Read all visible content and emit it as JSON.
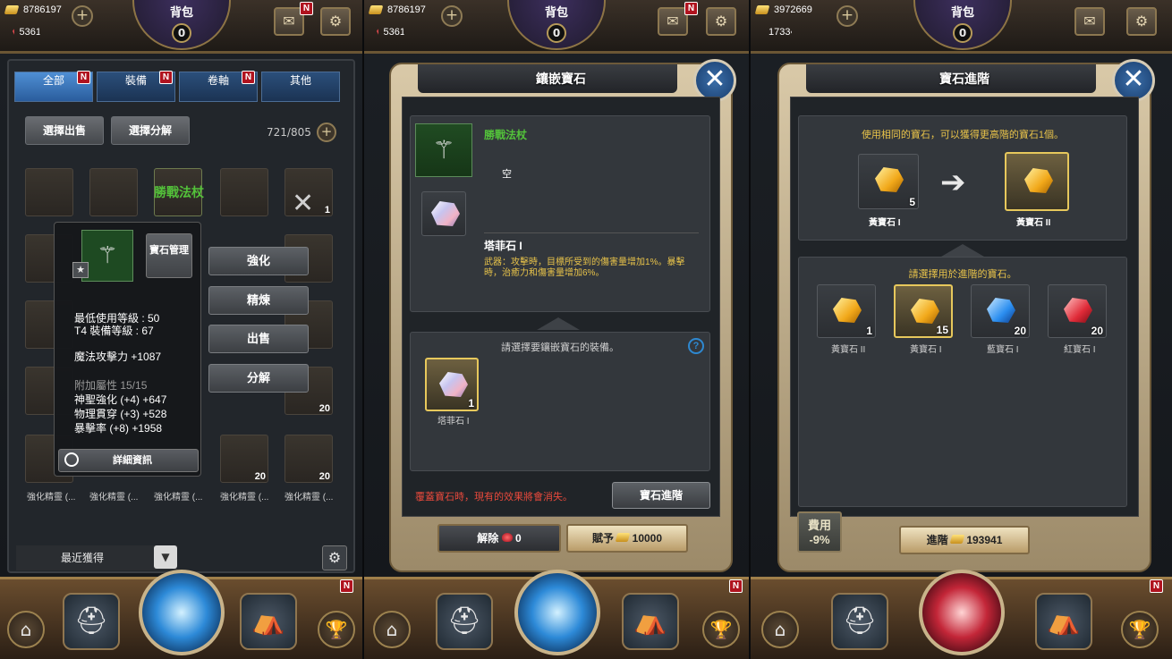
{
  "screens": [
    {
      "header": {
        "gold": "8786197",
        "gems": "5361",
        "title": "背包",
        "count": "0"
      },
      "tabs": [
        {
          "label": "全部",
          "badge": "N"
        },
        {
          "label": "裝備",
          "badge": "N"
        },
        {
          "label": "卷軸",
          "badge": "N"
        },
        {
          "label": "其他",
          "badge": ""
        }
      ],
      "select_sell": "選擇出售",
      "select_dismantle": "選擇分解",
      "capacity": "721/805",
      "grid_counts": [
        "1",
        "20",
        "20",
        "20",
        "20",
        "20",
        "20"
      ],
      "grid_labels": [
        "強化精靈 (...",
        "強化精靈 (...",
        "強化精靈 (...",
        "強化精靈 (...",
        "強化精靈 (..."
      ],
      "selected_item_name": "勝戰法杖",
      "tooltip": {
        "gem_manage": "寶石管理",
        "min_level": "最低使用等級 : 50",
        "t4_level": "T4 裝備等級 : 67",
        "magic_attack": "魔法攻擊力 +1087",
        "extra_attr": "附加屬性 15/15",
        "attr1": "神聖強化 (+4) +647",
        "attr2": "物理貫穿 (+3) +528",
        "attr3": "暴擊率 (+8) +1958",
        "detail": "詳細資訊"
      },
      "actions": [
        "強化",
        "精煉",
        "出售",
        "分解"
      ],
      "recent": "最近獲得"
    },
    {
      "header": {
        "gold": "8786197",
        "gems": "5361",
        "title": "背包",
        "count": "0"
      },
      "dialog_title": "鑲嵌寶石",
      "item_name": "勝戰法杖",
      "socket_empty": "空",
      "gem_name": "塔菲石 I",
      "gem_desc": "武器：攻擊時，目標所受到的傷害量增加1%。暴擊時，治癒力和傷害量增加6%。",
      "select_prompt": "請選擇要鑲嵌寶石的裝備。",
      "help": "?",
      "candidate": {
        "name": "塔菲石 I",
        "count": "1"
      },
      "warning": "覆蓋寶石時，現有的效果將會消失。",
      "advance_btn": "寶石進階",
      "remove_btn": "解除",
      "remove_cost": "0",
      "apply_btn": "賦予",
      "apply_cost": "10000"
    },
    {
      "header": {
        "gold": "3972669",
        "gems": "17330",
        "title": "背包",
        "count": "0"
      },
      "dialog_title": "寶石進階",
      "info": "使用相同的寶石，可以獲得更高階的寶石1個。",
      "from_gem": {
        "name": "黃寶石 I",
        "count": "5"
      },
      "to_gem": {
        "name": "黃寶石 II"
      },
      "choose_prompt": "請選擇用於進階的寶石。",
      "gems": [
        {
          "name": "黃寶石 II",
          "count": "1",
          "color": "yellow"
        },
        {
          "name": "黃寶石 I",
          "count": "15",
          "color": "yellow"
        },
        {
          "name": "藍寶石 I",
          "count": "20",
          "color": "blue"
        },
        {
          "name": "紅寶石 I",
          "count": "20",
          "color": "red"
        }
      ],
      "fee_label": "費用",
      "fee_value": "-9%",
      "advance_btn": "進階",
      "advance_cost": "193941"
    }
  ],
  "colors": {
    "green_text": "#53c23a",
    "warning": "#e8493c",
    "gold_text": "#e8c34a",
    "tab_active": "#4f8fd4"
  }
}
